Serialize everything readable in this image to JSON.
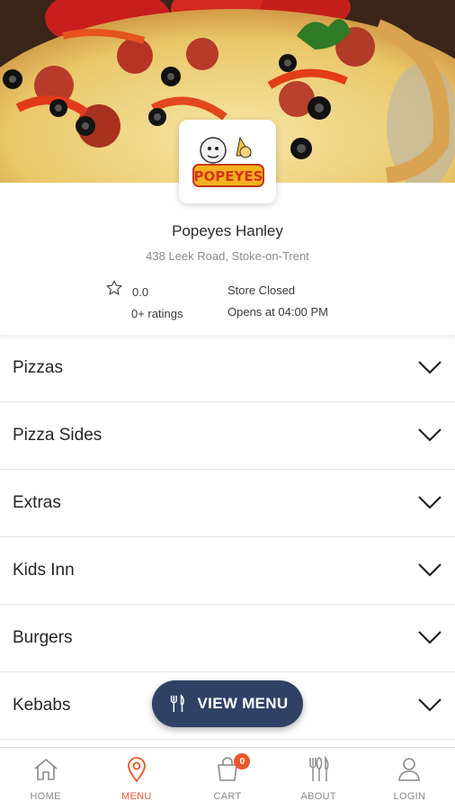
{
  "store": {
    "name": "Popeyes Hanley",
    "address": "438 Leek Road, Stoke-on-Trent",
    "rating_value": "0.0",
    "rating_count": "0+ ratings",
    "status": "Store Closed",
    "opens": "Opens at 04:00 PM",
    "logo_text": "POPEYES"
  },
  "categories": [
    {
      "label": "Pizzas"
    },
    {
      "label": "Pizza Sides"
    },
    {
      "label": "Extras"
    },
    {
      "label": "Kids Inn"
    },
    {
      "label": "Burgers"
    },
    {
      "label": "Kebabs"
    }
  ],
  "view_menu": {
    "label": "VIEW MENU",
    "icon": "fork-knife-icon"
  },
  "nav": [
    {
      "label": "HOME",
      "icon": "home-icon"
    },
    {
      "label": "MENU",
      "icon": "location-pin-icon",
      "active": true
    },
    {
      "label": "CART",
      "icon": "bag-icon",
      "badge": "0"
    },
    {
      "label": "ABOUT",
      "icon": "cutlery-icon"
    },
    {
      "label": "LOGIN",
      "icon": "user-icon"
    }
  ],
  "colors": {
    "accent": "#e8572d",
    "button_bg": "#2f4266",
    "text_muted": "#8a8a8a"
  }
}
